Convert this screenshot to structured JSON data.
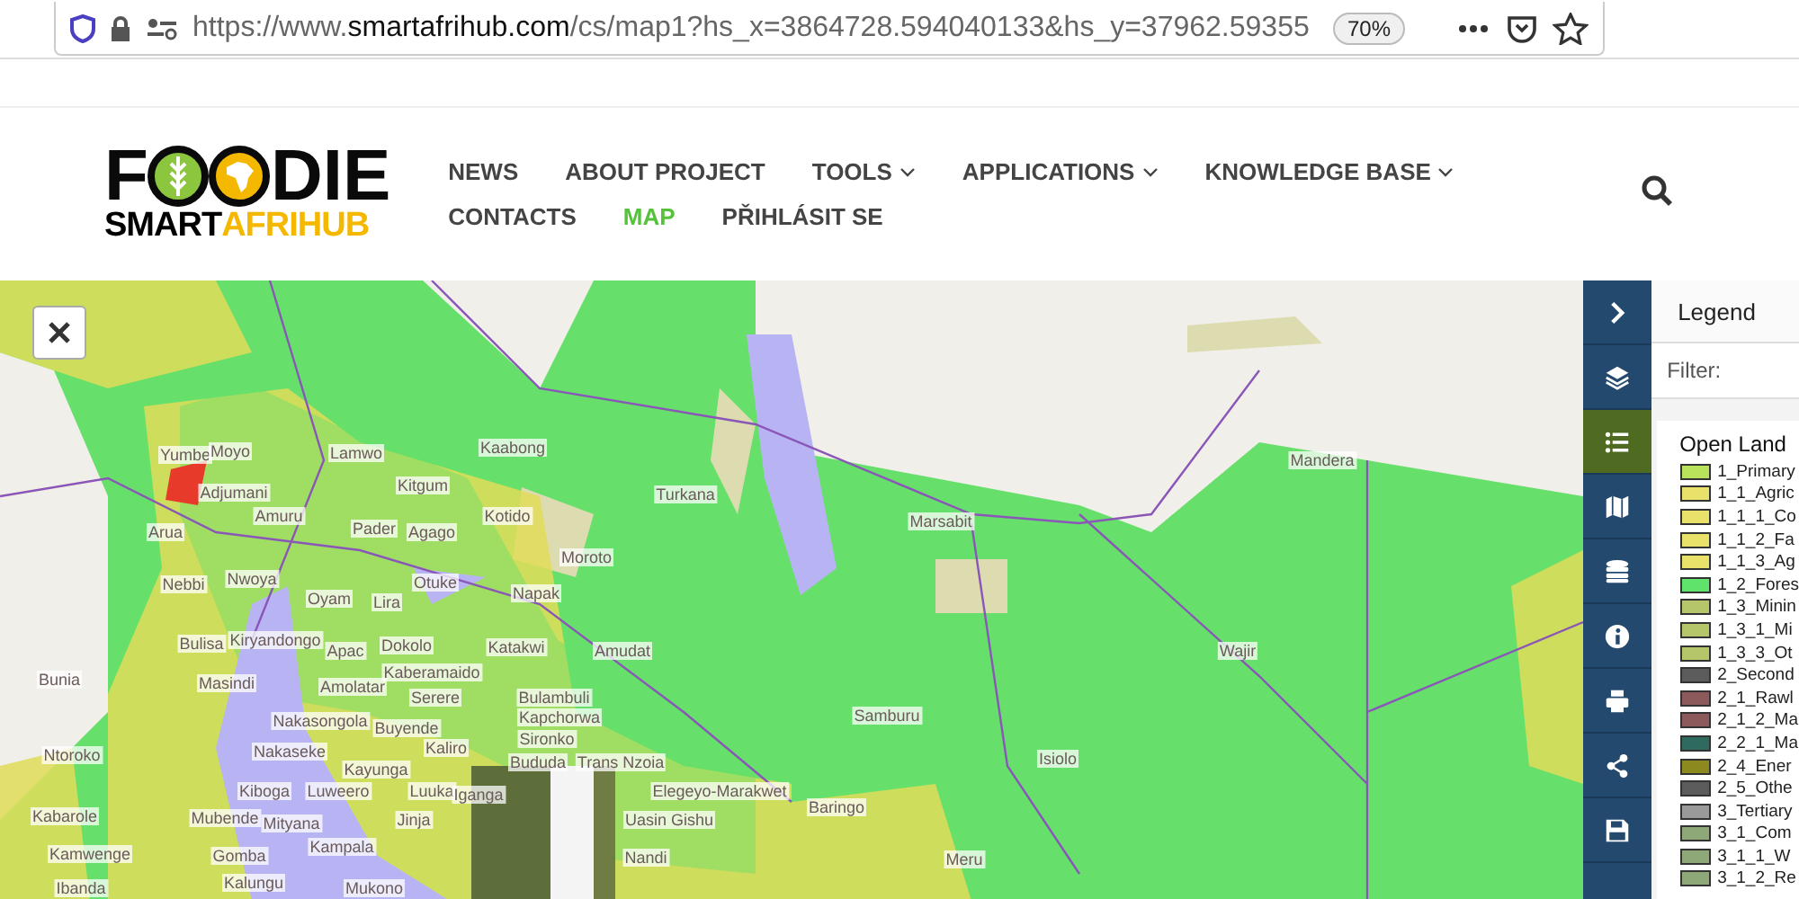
{
  "browser": {
    "url_prefix": "https://www.",
    "url_domain": "smartafrihub.com",
    "url_rest": "/cs/map1?hs_x=3864728.594040133&hs_y=37962.59355",
    "zoom": "70%"
  },
  "logo": {
    "start": "F",
    "end": "DIE",
    "sub_a": "SMART",
    "sub_b": "AFRIHUB"
  },
  "nav": [
    {
      "label": "NEWS",
      "dropdown": false,
      "selected": false
    },
    {
      "label": "ABOUT PROJECT",
      "dropdown": false,
      "selected": false
    },
    {
      "label": "TOOLS",
      "dropdown": true,
      "selected": false
    },
    {
      "label": "APPLICATIONS",
      "dropdown": true,
      "selected": false
    },
    {
      "label": "KNOWLEDGE BASE",
      "dropdown": true,
      "selected": false
    },
    {
      "label": "CONTACTS",
      "dropdown": false,
      "selected": false
    },
    {
      "label": "MAP",
      "dropdown": false,
      "selected": true
    },
    {
      "label": "PŘIHLÁSIT SE",
      "dropdown": false,
      "selected": false
    }
  ],
  "map_labels": [
    "Yumbe",
    "Moyo",
    "Lamwo",
    "Kaabong",
    "Mandera",
    "Adjumani",
    "Kitgum",
    "Turkana",
    "Arua",
    "Amuru",
    "Pader",
    "Agago",
    "Kotido",
    "Marsabit",
    "Moroto",
    "Nebbi",
    "Nwoya",
    "Oyam",
    "Lira",
    "Otuke",
    "Napak",
    "Bulisa",
    "Kiryandongo",
    "Apac",
    "Dokolo",
    "Katakwi",
    "Amudat",
    "Wajir",
    "Bunia",
    "Masindi",
    "Amolatar",
    "Kaberamaido",
    "Serere",
    "Bulambuli",
    "Nakasongola",
    "Buyende",
    "Kapchorwa",
    "Samburu",
    "Ntoroko",
    "Nakaseke",
    "Kaliro",
    "Sironko",
    "Kayunga",
    "Bududa",
    "Trans Nzoia",
    "Isiolo",
    "Kiboga",
    "Luweero",
    "Luuka",
    "Iganga",
    "Elegeyo-Marakwet",
    "Kabarole",
    "Mubende",
    "Mityana",
    "Jinja",
    "Uasin Gishu",
    "Baringo",
    "Kamwenge",
    "Gomba",
    "Kampala",
    "Nandi",
    "Meru",
    "Ibanda",
    "Kalungu",
    "Mukono"
  ],
  "tools": [
    {
      "kind": "collapse",
      "selected": false
    },
    {
      "kind": "layers",
      "selected": false
    },
    {
      "kind": "legend",
      "selected": true
    },
    {
      "kind": "map",
      "selected": false
    },
    {
      "kind": "database",
      "selected": false
    },
    {
      "kind": "info",
      "selected": false
    },
    {
      "kind": "print",
      "selected": false
    },
    {
      "kind": "share",
      "selected": false
    },
    {
      "kind": "save",
      "selected": false
    }
  ],
  "legend": {
    "title": "Legend",
    "filter_label": "Filter:",
    "group": "Open Land",
    "items": [
      {
        "label": "1_Primary",
        "color": "#b8e35a"
      },
      {
        "label": "1_1_Agric",
        "color": "#e8e26a"
      },
      {
        "label": "1_1_1_Co",
        "color": "#e8e26a"
      },
      {
        "label": "1_1_2_Fa",
        "color": "#e8e26a"
      },
      {
        "label": "1_1_3_Ag",
        "color": "#e8e26a"
      },
      {
        "label": "1_2_Fores",
        "color": "#5fe36a"
      },
      {
        "label": "1_3_Minin",
        "color": "#b5c56a"
      },
      {
        "label": "1_3_1_Mi",
        "color": "#b5c56a"
      },
      {
        "label": "1_3_3_Ot",
        "color": "#b5c56a"
      },
      {
        "label": "2_Second",
        "color": "#5c5c5c"
      },
      {
        "label": "2_1_Rawl",
        "color": "#8c5a5a"
      },
      {
        "label": "2_1_2_Ma",
        "color": "#8c5a5a"
      },
      {
        "label": "2_2_1_Ma",
        "color": "#2e6a5e"
      },
      {
        "label": "2_4_Ener",
        "color": "#8c8a1e"
      },
      {
        "label": "2_5_Othe",
        "color": "#5c5c5c"
      },
      {
        "label": "3_Tertiary",
        "color": "#9a9a9a"
      },
      {
        "label": "3_1_Com",
        "color": "#8fa878"
      },
      {
        "label": "3_1_1_W",
        "color": "#8fa878"
      },
      {
        "label": "3_1_2_Re",
        "color": "#8fa878"
      }
    ]
  }
}
